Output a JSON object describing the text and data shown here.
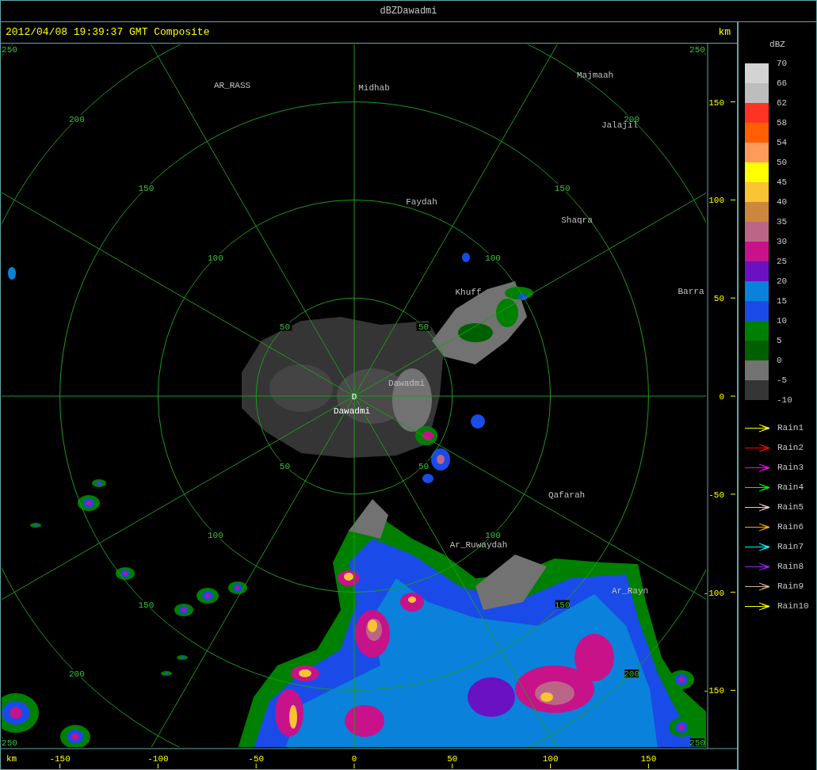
{
  "window": {
    "title": "dBZDawadmi"
  },
  "header": {
    "timestamp": "2012/04/08 19:39:37 GMT Composite",
    "unit": "km"
  },
  "radar_map": {
    "range_ring_labels": [
      "250",
      "200",
      "150",
      "100",
      "50",
      "50",
      "100",
      "150",
      "200",
      "250",
      "50",
      "100",
      "150",
      "200",
      "250",
      "50",
      "100",
      "150",
      "200",
      "250"
    ],
    "places": [
      {
        "name": "AR_RASS",
        "kind": "town"
      },
      {
        "name": "Midhab",
        "kind": "town"
      },
      {
        "name": "Majmaah",
        "kind": "town"
      },
      {
        "name": "Jalajil",
        "kind": "town"
      },
      {
        "name": "Faydah",
        "kind": "town"
      },
      {
        "name": "Shaqra",
        "kind": "town"
      },
      {
        "name": "Khuff",
        "kind": "town"
      },
      {
        "name": "Barra",
        "kind": "town"
      },
      {
        "name": "Dawadmi",
        "kind": "town"
      },
      {
        "name": "D",
        "kind": "radar_site"
      },
      {
        "name": "Dawadmi",
        "kind": "radar_label"
      },
      {
        "name": "Qafarah",
        "kind": "town"
      },
      {
        "name": "Ar_Ruwaydah",
        "kind": "town"
      },
      {
        "name": "Ar_Rayn",
        "kind": "town"
      }
    ],
    "y_ticks": [
      "150",
      "100",
      "50",
      "0",
      "-50",
      "-100",
      "-150"
    ],
    "x_unit": "km",
    "x_ticks": [
      "-150",
      "-100",
      "-50",
      "0",
      "50",
      "100",
      "150"
    ]
  },
  "legend": {
    "title": "dBZ",
    "scale": [
      {
        "color": "#d3d3d3"
      },
      {
        "color": "#bdbdbd"
      },
      {
        "color": "#ff3322"
      },
      {
        "color": "#ff5f00"
      },
      {
        "color": "#ff9b5a"
      },
      {
        "color": "#ffff00"
      },
      {
        "color": "#f9c333"
      },
      {
        "color": "#cd873d"
      },
      {
        "color": "#bc6687"
      },
      {
        "color": "#c7128a"
      },
      {
        "color": "#6a12c3"
      },
      {
        "color": "#0a82dc"
      },
      {
        "color": "#1a4be8"
      },
      {
        "color": "#008000"
      },
      {
        "color": "#006000"
      },
      {
        "color": "#727272"
      },
      {
        "color": "#353535"
      }
    ],
    "scale_labels": [
      "70",
      "66",
      "62",
      "58",
      "54",
      "50",
      "45",
      "40",
      "35",
      "30",
      "25",
      "20",
      "15",
      "10",
      "5",
      "0",
      "-5",
      "-10"
    ],
    "tracks": [
      {
        "label": "Rain1",
        "color": "#ffff00"
      },
      {
        "label": "Rain2",
        "color": "#ff0000"
      },
      {
        "label": "Rain3",
        "color": "#ff00ff"
      },
      {
        "label": "Rain4",
        "color": "#00ff00"
      },
      {
        "label": "Rain5",
        "color": "#ffc0cb"
      },
      {
        "label": "Rain6",
        "color": "#ffa500"
      },
      {
        "label": "Rain7",
        "color": "#00ffff"
      },
      {
        "label": "Rain8",
        "color": "#a020f0"
      },
      {
        "label": "Rain9",
        "color": "#d2b48c"
      },
      {
        "label": "Rain10",
        "color": "#ffff00"
      }
    ]
  }
}
